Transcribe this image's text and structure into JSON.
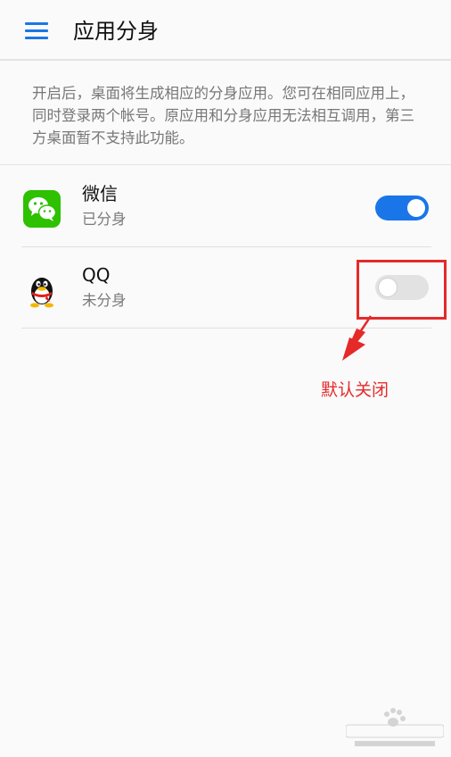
{
  "header": {
    "title": "应用分身"
  },
  "description": "开启后，桌面将生成相应的分身应用。您可在相同应用上，同时登录两个帐号。原应用和分身应用无法相互调用，第三方桌面暂不支持此功能。",
  "apps": [
    {
      "name": "微信",
      "status": "已分身",
      "enabled": true,
      "icon": "wechat-icon"
    },
    {
      "name": "QQ",
      "status": "未分身",
      "enabled": false,
      "icon": "qq-icon"
    }
  ],
  "annotation": {
    "text": "默认关闭"
  },
  "colors": {
    "accent": "#1a76e8",
    "annotation": "#e52a2a",
    "wechat": "#2dc100"
  }
}
